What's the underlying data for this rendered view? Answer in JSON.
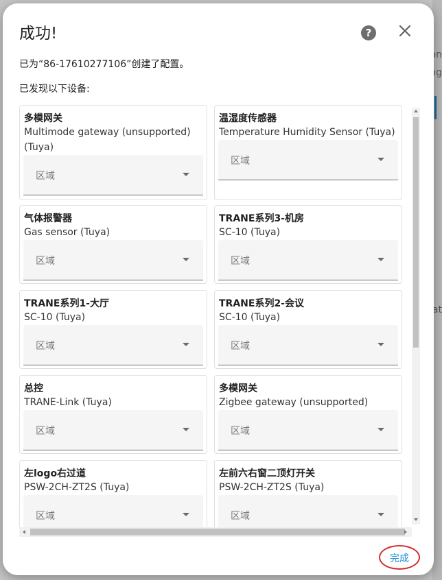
{
  "dialog": {
    "title": "成功!",
    "created_text": "已为“86-17610277106”创建了配置。",
    "found_text": "已发现以下设备:",
    "done_label": "完成",
    "help_icon": "?",
    "area_label": "区域"
  },
  "background": {
    "fragments": [
      "on",
      "ng",
      "at"
    ]
  },
  "devices": [
    {
      "name": "多模网关",
      "model": "Multimode gateway (unsupported) (Tuya)"
    },
    {
      "name": "温湿度传感器",
      "model": "Temperature Humidity Sensor (Tuya)"
    },
    {
      "name": "气体报警器",
      "model": "Gas sensor (Tuya)"
    },
    {
      "name": "TRANE系列3-机房",
      "model": "SC-10 (Tuya)"
    },
    {
      "name": "TRANE系列1-大厅",
      "model": "SC-10 (Tuya)"
    },
    {
      "name": "TRANE系列2-会议",
      "model": "SC-10 (Tuya)"
    },
    {
      "name": "总控",
      "model": "TRANE-Link (Tuya)"
    },
    {
      "name": "多模网关",
      "model": "Zigbee gateway (unsupported) (Tuya)"
    },
    {
      "name": "左logo右过道",
      "model": "PSW-2CH-ZT2S (Tuya)"
    },
    {
      "name": "左前六右窗二顶灯开关",
      "model": "PSW-2CH-ZT2S (Tuya)"
    }
  ],
  "colors": {
    "accent": "#1e8fcf",
    "highlight_ring": "#d42a2a"
  },
  "icons": {
    "help": "help-circle-icon",
    "close": "close-icon",
    "dropdown": "chevron-down-icon"
  }
}
